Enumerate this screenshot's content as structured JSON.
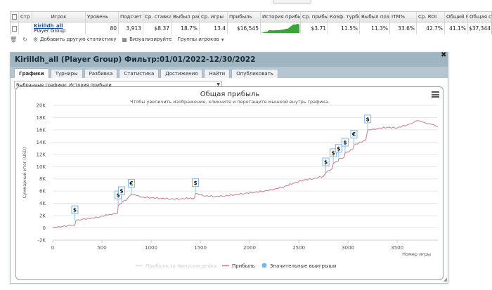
{
  "grid": {
    "columns": [
      {
        "label": "",
        "w": 12
      },
      {
        "label": "Стр",
        "w": 19
      },
      {
        "label": "Игрок",
        "w": 76
      },
      {
        "label": "Уровень",
        "w": 47
      },
      {
        "label": "Подсчет",
        "w": 35
      },
      {
        "label": "Ср. ставка",
        "w": 40
      },
      {
        "label": "Выбыл ран",
        "w": 40
      },
      {
        "label": "Ср. игры",
        "w": 40
      },
      {
        "label": "Прибыль",
        "w": 47
      },
      {
        "label": "История прибыл",
        "w": 57
      },
      {
        "label": "Ср. прибы",
        "w": 39
      },
      {
        "label": "Коэф. турбс",
        "w": 45
      },
      {
        "label": "Выбыл поз",
        "w": 43
      },
      {
        "label": "ITM%",
        "w": 38
      },
      {
        "label": "Ср. ROI",
        "w": 40
      },
      {
        "label": "Общий R",
        "w": 33
      },
      {
        "label": "Общая ставк",
        "w": 35
      }
    ],
    "row": {
      "player_name": "Kirilldh_all",
      "player_group": "Player Group",
      "values": [
        "80",
        "3,913",
        "$8.37",
        "18.7%",
        "13.4",
        "$16,545",
        "",
        "$3.71",
        "11.5%",
        "11.3%",
        "33.6%",
        "42.7%",
        "41.1%",
        "$37,344"
      ]
    }
  },
  "toolbar": {
    "add_stats": "Добавить другую статистику",
    "visualize": "Визуализируйте",
    "groups": "Группы игроков"
  },
  "dialog": {
    "title": "Kirilldh_all (Player Group) Фильтр:01/01/2022-12/30/2022",
    "tabs": [
      "Графики",
      "Турниры",
      "Разбивка",
      "Статистика",
      "Достижения",
      "Найти",
      "Опубликовать"
    ],
    "select_label": "Выбранные графики: История прибыли"
  },
  "chart_data": {
    "type": "line",
    "title": "Общая прибыль",
    "subtitle": "Чтобы увеличить изображение, кликните и перетащите мышкой внутрь графика.",
    "xlabel": "Номер игры",
    "ylabel": "Суммарный итог (USD)",
    "xlim": [
      0,
      3913
    ],
    "ylim": [
      -2000,
      20000
    ],
    "x_ticks": [
      0,
      500,
      1000,
      1500,
      2000,
      2500,
      3000,
      3500
    ],
    "y_ticks": [
      -2000,
      0,
      2000,
      4000,
      6000,
      8000,
      10000,
      12000,
      14000,
      16000,
      18000,
      20000
    ],
    "y_tick_labels": [
      "-2K",
      "0",
      "2K",
      "4K",
      "6K",
      "8K",
      "10K",
      "12K",
      "14K",
      "16K",
      "18K",
      "20K"
    ],
    "grid": true,
    "legend_position": "bottom",
    "series": [
      {
        "name": "Прибыль за минусом рейка",
        "color": "#dddddd",
        "x": [],
        "y": []
      },
      {
        "name": "Прибыль",
        "color": "#c77b84",
        "x": [
          0,
          40,
          100,
          180,
          225,
          235,
          300,
          380,
          480,
          560,
          640,
          660,
          665,
          700,
          710,
          745,
          760,
          780,
          800,
          850,
          900,
          1000,
          1100,
          1200,
          1300,
          1440,
          1450,
          1550,
          1650,
          1750,
          1850,
          1950,
          2050,
          2150,
          2250,
          2350,
          2450,
          2550,
          2650,
          2750,
          2775,
          2840,
          2850,
          2900,
          2905,
          2960,
          2970,
          3050,
          3060,
          3180,
          3200,
          3230,
          3300,
          3400,
          3500,
          3600,
          3650,
          3700,
          3750,
          3800,
          3850,
          3913
        ],
        "y": [
          0,
          100,
          250,
          350,
          400,
          1200,
          1400,
          1500,
          1800,
          2100,
          2300,
          2400,
          3600,
          4000,
          4300,
          4500,
          4800,
          5200,
          5500,
          5300,
          5000,
          4900,
          4800,
          4700,
          4700,
          4900,
          5600,
          5200,
          5100,
          5200,
          5400,
          5600,
          5800,
          6000,
          6300,
          6700,
          7300,
          7800,
          8000,
          8400,
          9000,
          9700,
          10500,
          10900,
          11200,
          11500,
          12200,
          12800,
          13500,
          14300,
          16000,
          16000,
          16200,
          16400,
          16300,
          16800,
          17000,
          17500,
          17300,
          17000,
          16900,
          16550
        ]
      },
      {
        "name": "Значительные выигрыши",
        "color": "#7cb5ec",
        "x": [
          225,
          665,
          700,
          800,
          1450,
          2775,
          2850,
          2905,
          2970,
          3060,
          3200
        ],
        "y": [
          1200,
          3600,
          4300,
          5500,
          5600,
          9000,
          10500,
          11200,
          12200,
          13500,
          16000
        ]
      }
    ],
    "big_win_markers": [
      {
        "label": "$"
      },
      {
        "label": "$"
      },
      {
        "label": "$"
      },
      {
        "label": "€"
      },
      {
        "label": "$"
      },
      {
        "label": "$"
      },
      {
        "label": "$"
      },
      {
        "label": "$"
      },
      {
        "label": "$"
      },
      {
        "label": "€"
      },
      {
        "label": "$"
      }
    ]
  }
}
